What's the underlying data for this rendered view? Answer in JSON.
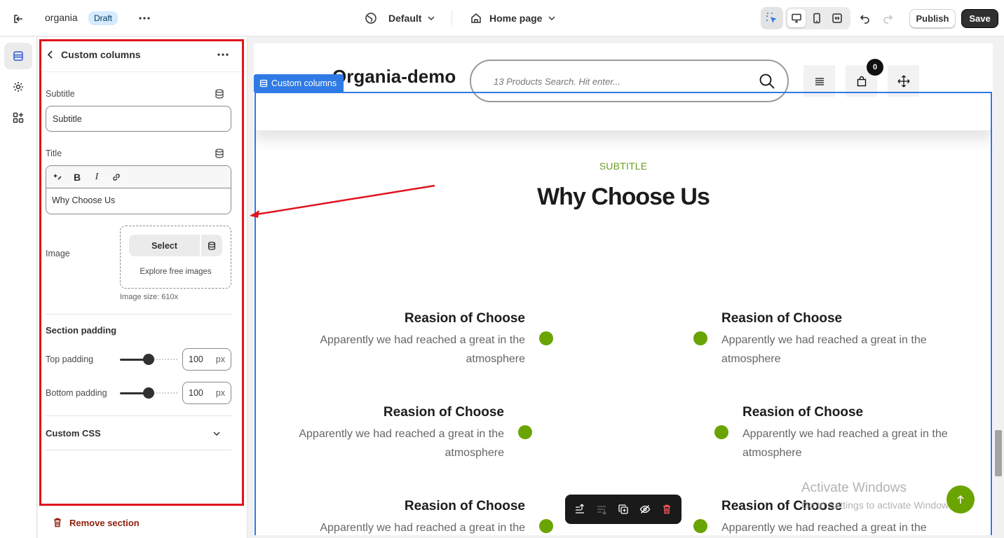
{
  "topbar": {
    "store_name": "organia",
    "status_badge": "Draft",
    "theme_selector": "Default",
    "page_selector": "Home page",
    "publish_label": "Publish",
    "save_label": "Save"
  },
  "panel": {
    "title": "Custom columns",
    "subtitle_label": "Subtitle",
    "subtitle_value": "Subtitle",
    "title_label": "Title",
    "title_value": "Why Choose Us",
    "image_label": "Image",
    "image_select": "Select",
    "image_explore": "Explore free images",
    "image_size": "Image size: 610x",
    "section_padding": "Section padding",
    "top_padding_label": "Top padding",
    "top_padding_value": "100",
    "bottom_padding_label": "Bottom padding",
    "bottom_padding_value": "100",
    "padding_unit": "px",
    "custom_css": "Custom CSS",
    "remove_section": "Remove section"
  },
  "preview": {
    "logo": "Organia-demo",
    "search_placeholder": "13 Products Search. Hit enter...",
    "cart_count": "0",
    "selection_tag": "Custom columns",
    "section_subtitle": "SUBTITLE",
    "section_title": "Why Choose Us",
    "features": [
      {
        "title": "Reasion of Choose",
        "text": "Apparently we had reached a great in the atmosphere"
      },
      {
        "title": "Reasion of Choose",
        "text": "Apparently we had reached a great in the atmosphere"
      },
      {
        "title": "Reasion of Choose",
        "text": "Apparently we had reached a great in the atmosphere"
      },
      {
        "title": "Reasion of Choose",
        "text": "Apparently we had reached a great in the atmosphere"
      },
      {
        "title": "Reasion of Choose",
        "text": "Apparently we had reached a great in the"
      },
      {
        "title": "Reasion of Choose",
        "text": "Apparently we had reached a great in the"
      }
    ],
    "watermark_line1": "Activate Windows",
    "watermark_line2": "Go to Settings to activate Windows."
  },
  "colors": {
    "accent_green": "#6aa400",
    "selection_blue": "#2f7ae5",
    "annotation_red": "#e0141e"
  },
  "padding_levels": {
    "top_padding_fraction": 0.5,
    "bottom_padding_fraction": 0.5
  }
}
